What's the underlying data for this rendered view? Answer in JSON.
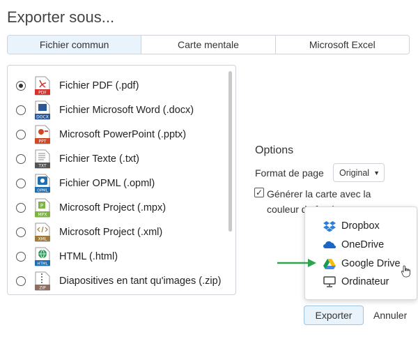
{
  "dialog": {
    "title": "Exporter sous..."
  },
  "tabs": [
    {
      "label": "Fichier commun",
      "active": true
    },
    {
      "label": "Carte mentale",
      "active": false
    },
    {
      "label": "Microsoft Excel",
      "active": false
    }
  ],
  "formats": [
    {
      "label": "Fichier PDF (.pdf)",
      "icon": "pdf-file-icon",
      "icon_text": "PDF",
      "checked": true
    },
    {
      "label": "Fichier Microsoft Word (.docx)",
      "icon": "docx-file-icon",
      "icon_text": "DOCX",
      "checked": false
    },
    {
      "label": "Microsoft PowerPoint (.pptx)",
      "icon": "ppt-file-icon",
      "icon_text": "PPT",
      "checked": false
    },
    {
      "label": "Fichier Texte (.txt)",
      "icon": "txt-file-icon",
      "icon_text": "TXT",
      "checked": false
    },
    {
      "label": "Fichier OPML (.opml)",
      "icon": "opml-file-icon",
      "icon_text": "OPML",
      "checked": false
    },
    {
      "label": "Microsoft Project (.mpx)",
      "icon": "mpx-file-icon",
      "icon_text": "MPX",
      "checked": false
    },
    {
      "label": "Microsoft Project (.xml)",
      "icon": "xml-file-icon",
      "icon_text": "XML",
      "checked": false
    },
    {
      "label": "HTML (.html)",
      "icon": "html-file-icon",
      "icon_text": "HTML",
      "checked": false
    },
    {
      "label": "Diapositives en tant qu'images (.zip)",
      "icon": "zip-file-icon",
      "icon_text": "ZIP",
      "checked": false
    }
  ],
  "options": {
    "title": "Options",
    "format_label": "Format de page",
    "format_value": "Original",
    "color_checkbox_checked": true,
    "color_checkbox_label": "Générer la carte avec la couleur de fond"
  },
  "destinations": [
    {
      "label": "Dropbox",
      "icon": "dropbox-icon"
    },
    {
      "label": "OneDrive",
      "icon": "onedrive-icon"
    },
    {
      "label": "Google Drive",
      "icon": "google-drive-icon"
    },
    {
      "label": "Ordinateur",
      "icon": "computer-icon"
    }
  ],
  "buttons": {
    "export": "Exporter",
    "cancel": "Annuler"
  },
  "colors": {
    "accent": "#e8f3fb",
    "arrow": "#2ea44f",
    "pdf_red": "#d9312b"
  }
}
